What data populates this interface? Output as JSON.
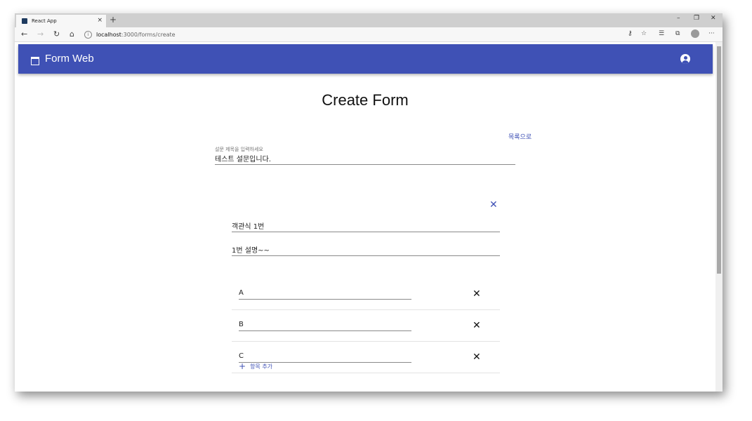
{
  "browser": {
    "tab_title": "React App",
    "tab_close": "×",
    "new_tab": "+",
    "url_host": "localhost",
    "url_path": ":3000/forms/create",
    "win_min": "–",
    "win_max": "❐",
    "win_close": "✕",
    "nav_back": "←",
    "nav_forward": "→",
    "nav_reload": "↻",
    "nav_home": "⌂",
    "tb_key": "⚷",
    "tb_star": "☆",
    "tb_favorites": "☰",
    "tb_collections": "⧉",
    "tb_more": "···"
  },
  "appbar": {
    "title": "Form Web"
  },
  "page": {
    "title": "Create Form",
    "back_link": "목록으로",
    "form_title_label": "설문 제목을 입력하세요",
    "form_title_value": "테스트 설문입니다."
  },
  "question": {
    "remove_icon": "✕",
    "title_value": "객관식 1번",
    "description_value": "1번 설명~~",
    "options": [
      {
        "value": "A",
        "remove": "✕"
      },
      {
        "value": "B",
        "remove": "✕"
      },
      {
        "value": "C",
        "remove": "✕"
      }
    ],
    "add_item_icon": "+",
    "add_item_label": "항목 추가"
  },
  "colors": {
    "primary": "#3f51b5"
  }
}
